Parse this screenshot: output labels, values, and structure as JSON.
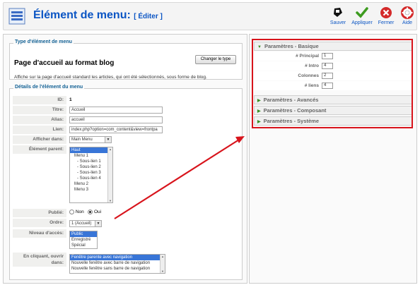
{
  "header": {
    "title": "Élément de menu:",
    "subtitle": "[ Éditer ]",
    "tools": [
      {
        "label": "Sauver",
        "icon": "save-icon"
      },
      {
        "label": "Appliquer",
        "icon": "apply-checkmark-icon"
      },
      {
        "label": "Fermer",
        "icon": "close-icon"
      },
      {
        "label": "Aide",
        "icon": "help-lifebuoy-icon"
      }
    ]
  },
  "type_section": {
    "legend": "Type d'élément de menu",
    "title": "Page d'accueil au format blog",
    "change_button": "Changer le type",
    "description": "Affiche sur la page d'accueil standard les articles, qui ont été sélectionnés, sous forme de blog."
  },
  "details": {
    "legend": "Détails de l'élément du menu",
    "id_label": "ID:",
    "id_value": "1",
    "title_label": "Titre:",
    "title_value": "Accueil",
    "alias_label": "Alias:",
    "alias_value": "accueil",
    "link_label": "Lien:",
    "link_value": "index.php?option=com_content&view=frontpa",
    "show_in_label": "Afficher dans:",
    "show_in_value": "Main Menu",
    "parent_label": "Élément parent:",
    "parent_options": [
      "Haut",
      "Menu 1",
      "- Sous-lien 1",
      "- Sous-lien 2",
      "- Sous-lien 3",
      "- Sous-lien 4",
      "Menu 2",
      "Menu 3"
    ],
    "published_label": "Publié:",
    "published_no": "Non",
    "published_yes": "Oui",
    "order_label": "Ordre:",
    "order_value": "1 (Accueil)",
    "access_label": "Niveau d'accès:",
    "access_options": [
      "Public",
      "Enregistré",
      "Spécial"
    ],
    "click_label": "En cliquant, ouvrir dans:",
    "click_options": [
      "Fenêtre parente avec navigation",
      "Nouvelle fenêtre avec barre de navigation",
      "Nouvelle fenêtre sans barre de navigation"
    ]
  },
  "params": {
    "basic_title": "Paramètres - Basique",
    "rows": [
      {
        "label": "# Principal",
        "value": "1"
      },
      {
        "label": "# Intro",
        "value": "4"
      },
      {
        "label": "Colonnes",
        "value": "2"
      },
      {
        "label": "# liens",
        "value": "4"
      }
    ],
    "advanced_title": "Paramètres - Avancés",
    "component_title": "Paramètres - Composant",
    "system_title": "Paramètres - Système"
  },
  "colors": {
    "accent": "#0b55c4",
    "annotation": "#d8141c"
  }
}
